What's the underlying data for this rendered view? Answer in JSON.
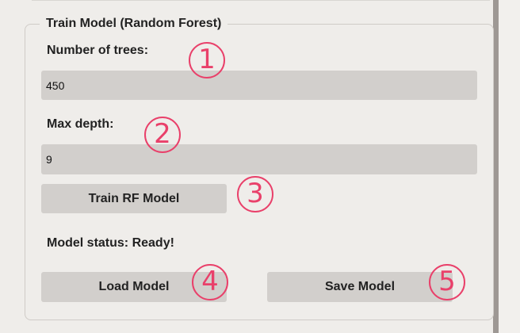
{
  "panel": {
    "title": "Train Model (Random Forest)",
    "trees_label": "Number of trees:",
    "trees_value": "450",
    "depth_label": "Max depth:",
    "depth_value": "9",
    "train_button": "Train RF Model",
    "status_text": "Model status: Ready!",
    "load_button": "Load Model",
    "save_button": "Save Model"
  },
  "annotations": [
    "1",
    "2",
    "3",
    "4",
    "5"
  ],
  "colors": {
    "annotation": "#e9406a",
    "field_bg": "#d2cfcc",
    "window_bg": "#efedea"
  }
}
